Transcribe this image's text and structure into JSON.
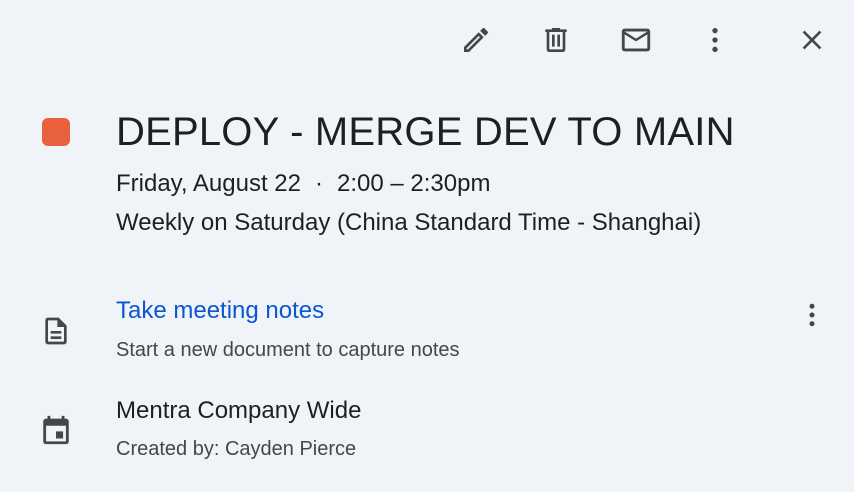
{
  "toolbar": {
    "edit_icon": "pencil-icon",
    "delete_icon": "trash-icon",
    "email_icon": "envelope-icon",
    "more_icon": "vertical-dots-icon",
    "close_icon": "close-icon"
  },
  "event": {
    "color": "#e8603c",
    "title": "DEPLOY - MERGE DEV TO MAIN",
    "date": "Friday, August 22",
    "separator": "·",
    "time": "2:00 – 2:30pm",
    "recurrence": "Weekly on Saturday (China Standard Time - Shanghai)"
  },
  "notes": {
    "icon": "document-icon",
    "link_label": "Take meeting notes",
    "subtitle": "Start a new document to capture notes",
    "more_icon": "vertical-dots-icon"
  },
  "calendar": {
    "icon": "calendar-icon",
    "name": "Mentra Company Wide",
    "creator": "Created by: Cayden Pierce"
  },
  "colors": {
    "background": "#f0f4f9",
    "link": "#0b57d0",
    "icon": "#444746"
  }
}
